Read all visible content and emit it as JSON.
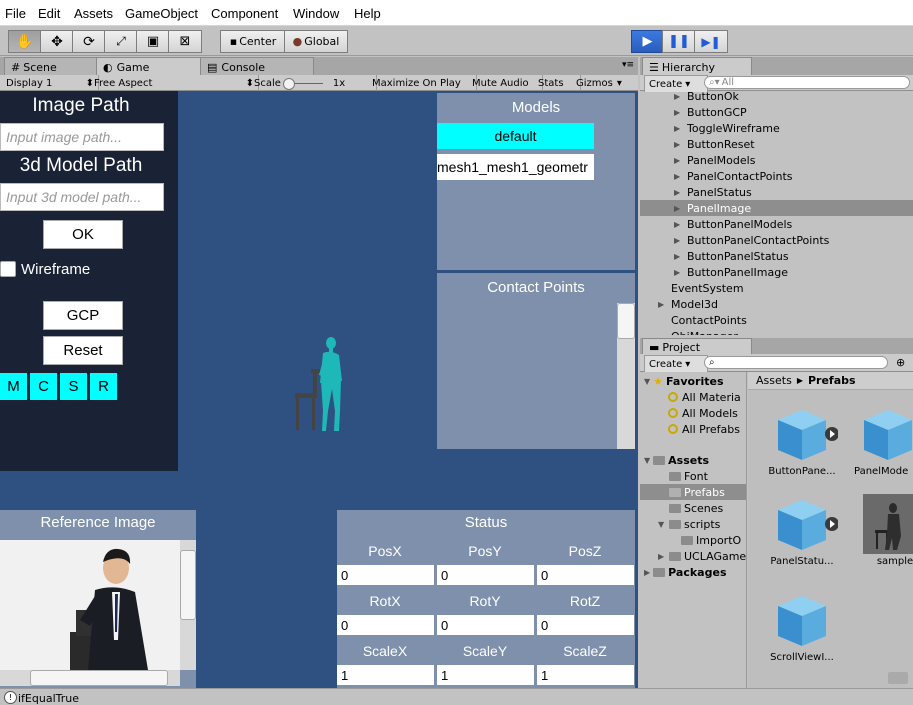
{
  "menu": [
    "File",
    "Edit",
    "Assets",
    "GameObject",
    "Component",
    "Window",
    "Help"
  ],
  "toolbar": {
    "pivot_label": "Center",
    "space_label": "Global"
  },
  "tabs": {
    "scene": "Scene",
    "game": "Game",
    "console": "Console",
    "hierarchy": "Hierarchy",
    "project": "Project"
  },
  "gamebar": {
    "display": "Display 1",
    "aspect": "Free Aspect",
    "scale_label": "Scale",
    "scale_value": "1x",
    "maximize": "Maximize On Play",
    "mute": "Mute Audio",
    "stats": "Stats",
    "gizmos": "Gizmos"
  },
  "left_panel": {
    "image_path_title": "Image Path",
    "image_path_placeholder": "Input image path...",
    "model_path_title": "3d Model Path",
    "model_path_placeholder": "Input 3d model path...",
    "ok_label": "OK",
    "wireframe_label": "Wireframe",
    "gcp_label": "GCP",
    "reset_label": "Reset",
    "small_buttons": [
      "M",
      "C",
      "S",
      "R"
    ]
  },
  "models_panel": {
    "title": "Models",
    "items": [
      "default",
      "mesh1_mesh1_geometr"
    ]
  },
  "contact_panel": {
    "title": "Contact Points"
  },
  "reference_panel": {
    "title": "Reference Image"
  },
  "status_panel": {
    "title": "Status",
    "rows": [
      {
        "labels": [
          "PosX",
          "PosY",
          "PosZ"
        ],
        "values": [
          "0",
          "0",
          "0"
        ]
      },
      {
        "labels": [
          "RotX",
          "RotY",
          "RotZ"
        ],
        "values": [
          "0",
          "0",
          "0"
        ]
      },
      {
        "labels": [
          "ScaleX",
          "ScaleY",
          "ScaleZ"
        ],
        "values": [
          "1",
          "1",
          "1"
        ]
      }
    ]
  },
  "hierarchy": {
    "create_label": "Create",
    "search_placeholder": "All",
    "items": [
      {
        "label": "ButtonOk",
        "indent": 2,
        "arrow": true,
        "selected": false
      },
      {
        "label": "ButtonGCP",
        "indent": 2,
        "arrow": true,
        "selected": false
      },
      {
        "label": "ToggleWireframe",
        "indent": 2,
        "arrow": true,
        "selected": false
      },
      {
        "label": "ButtonReset",
        "indent": 2,
        "arrow": true,
        "selected": false
      },
      {
        "label": "PanelModels",
        "indent": 2,
        "arrow": true,
        "selected": false
      },
      {
        "label": "PanelContactPoints",
        "indent": 2,
        "arrow": true,
        "selected": false
      },
      {
        "label": "PanelStatus",
        "indent": 2,
        "arrow": true,
        "selected": false
      },
      {
        "label": "PanelImage",
        "indent": 2,
        "arrow": true,
        "selected": true
      },
      {
        "label": "ButtonPanelModels",
        "indent": 2,
        "arrow": true,
        "selected": false
      },
      {
        "label": "ButtonPanelContactPoints",
        "indent": 2,
        "arrow": true,
        "selected": false
      },
      {
        "label": "ButtonPanelStatus",
        "indent": 2,
        "arrow": true,
        "selected": false
      },
      {
        "label": "ButtonPanelImage",
        "indent": 2,
        "arrow": true,
        "selected": false
      },
      {
        "label": "EventSystem",
        "indent": 1,
        "arrow": false,
        "selected": false
      },
      {
        "label": "Model3d",
        "indent": 1,
        "arrow": true,
        "selected": false
      },
      {
        "label": "ContactPoints",
        "indent": 1,
        "arrow": false,
        "selected": false
      },
      {
        "label": "ObjManager",
        "indent": 1,
        "arrow": false,
        "selected": false
      }
    ]
  },
  "project": {
    "create_label": "Create",
    "favorites_label": "Favorites",
    "favorites": [
      "All Materia",
      "All Models",
      "All Prefabs"
    ],
    "assets_label": "Assets",
    "asset_folders": [
      {
        "label": "Font",
        "indent": 1,
        "arrow": false,
        "selected": false
      },
      {
        "label": "Prefabs",
        "indent": 1,
        "arrow": false,
        "selected": true
      },
      {
        "label": "Scenes",
        "indent": 1,
        "arrow": false,
        "selected": false
      },
      {
        "label": "scripts",
        "indent": 1,
        "arrow": true,
        "selected": false
      },
      {
        "label": "ImportO",
        "indent": 2,
        "arrow": false,
        "selected": false
      },
      {
        "label": "UCLAGame",
        "indent": 1,
        "arrow": true,
        "selected": false
      }
    ],
    "packages_label": "Packages",
    "breadcrumb_root": "Assets",
    "breadcrumb_current": "Prefabs",
    "assets": [
      "ButtonPane...",
      "PanelMode",
      "PanelStatu...",
      "sample",
      "ScrollViewI..."
    ]
  },
  "statusbar": {
    "message": "ifEqualTrue"
  }
}
